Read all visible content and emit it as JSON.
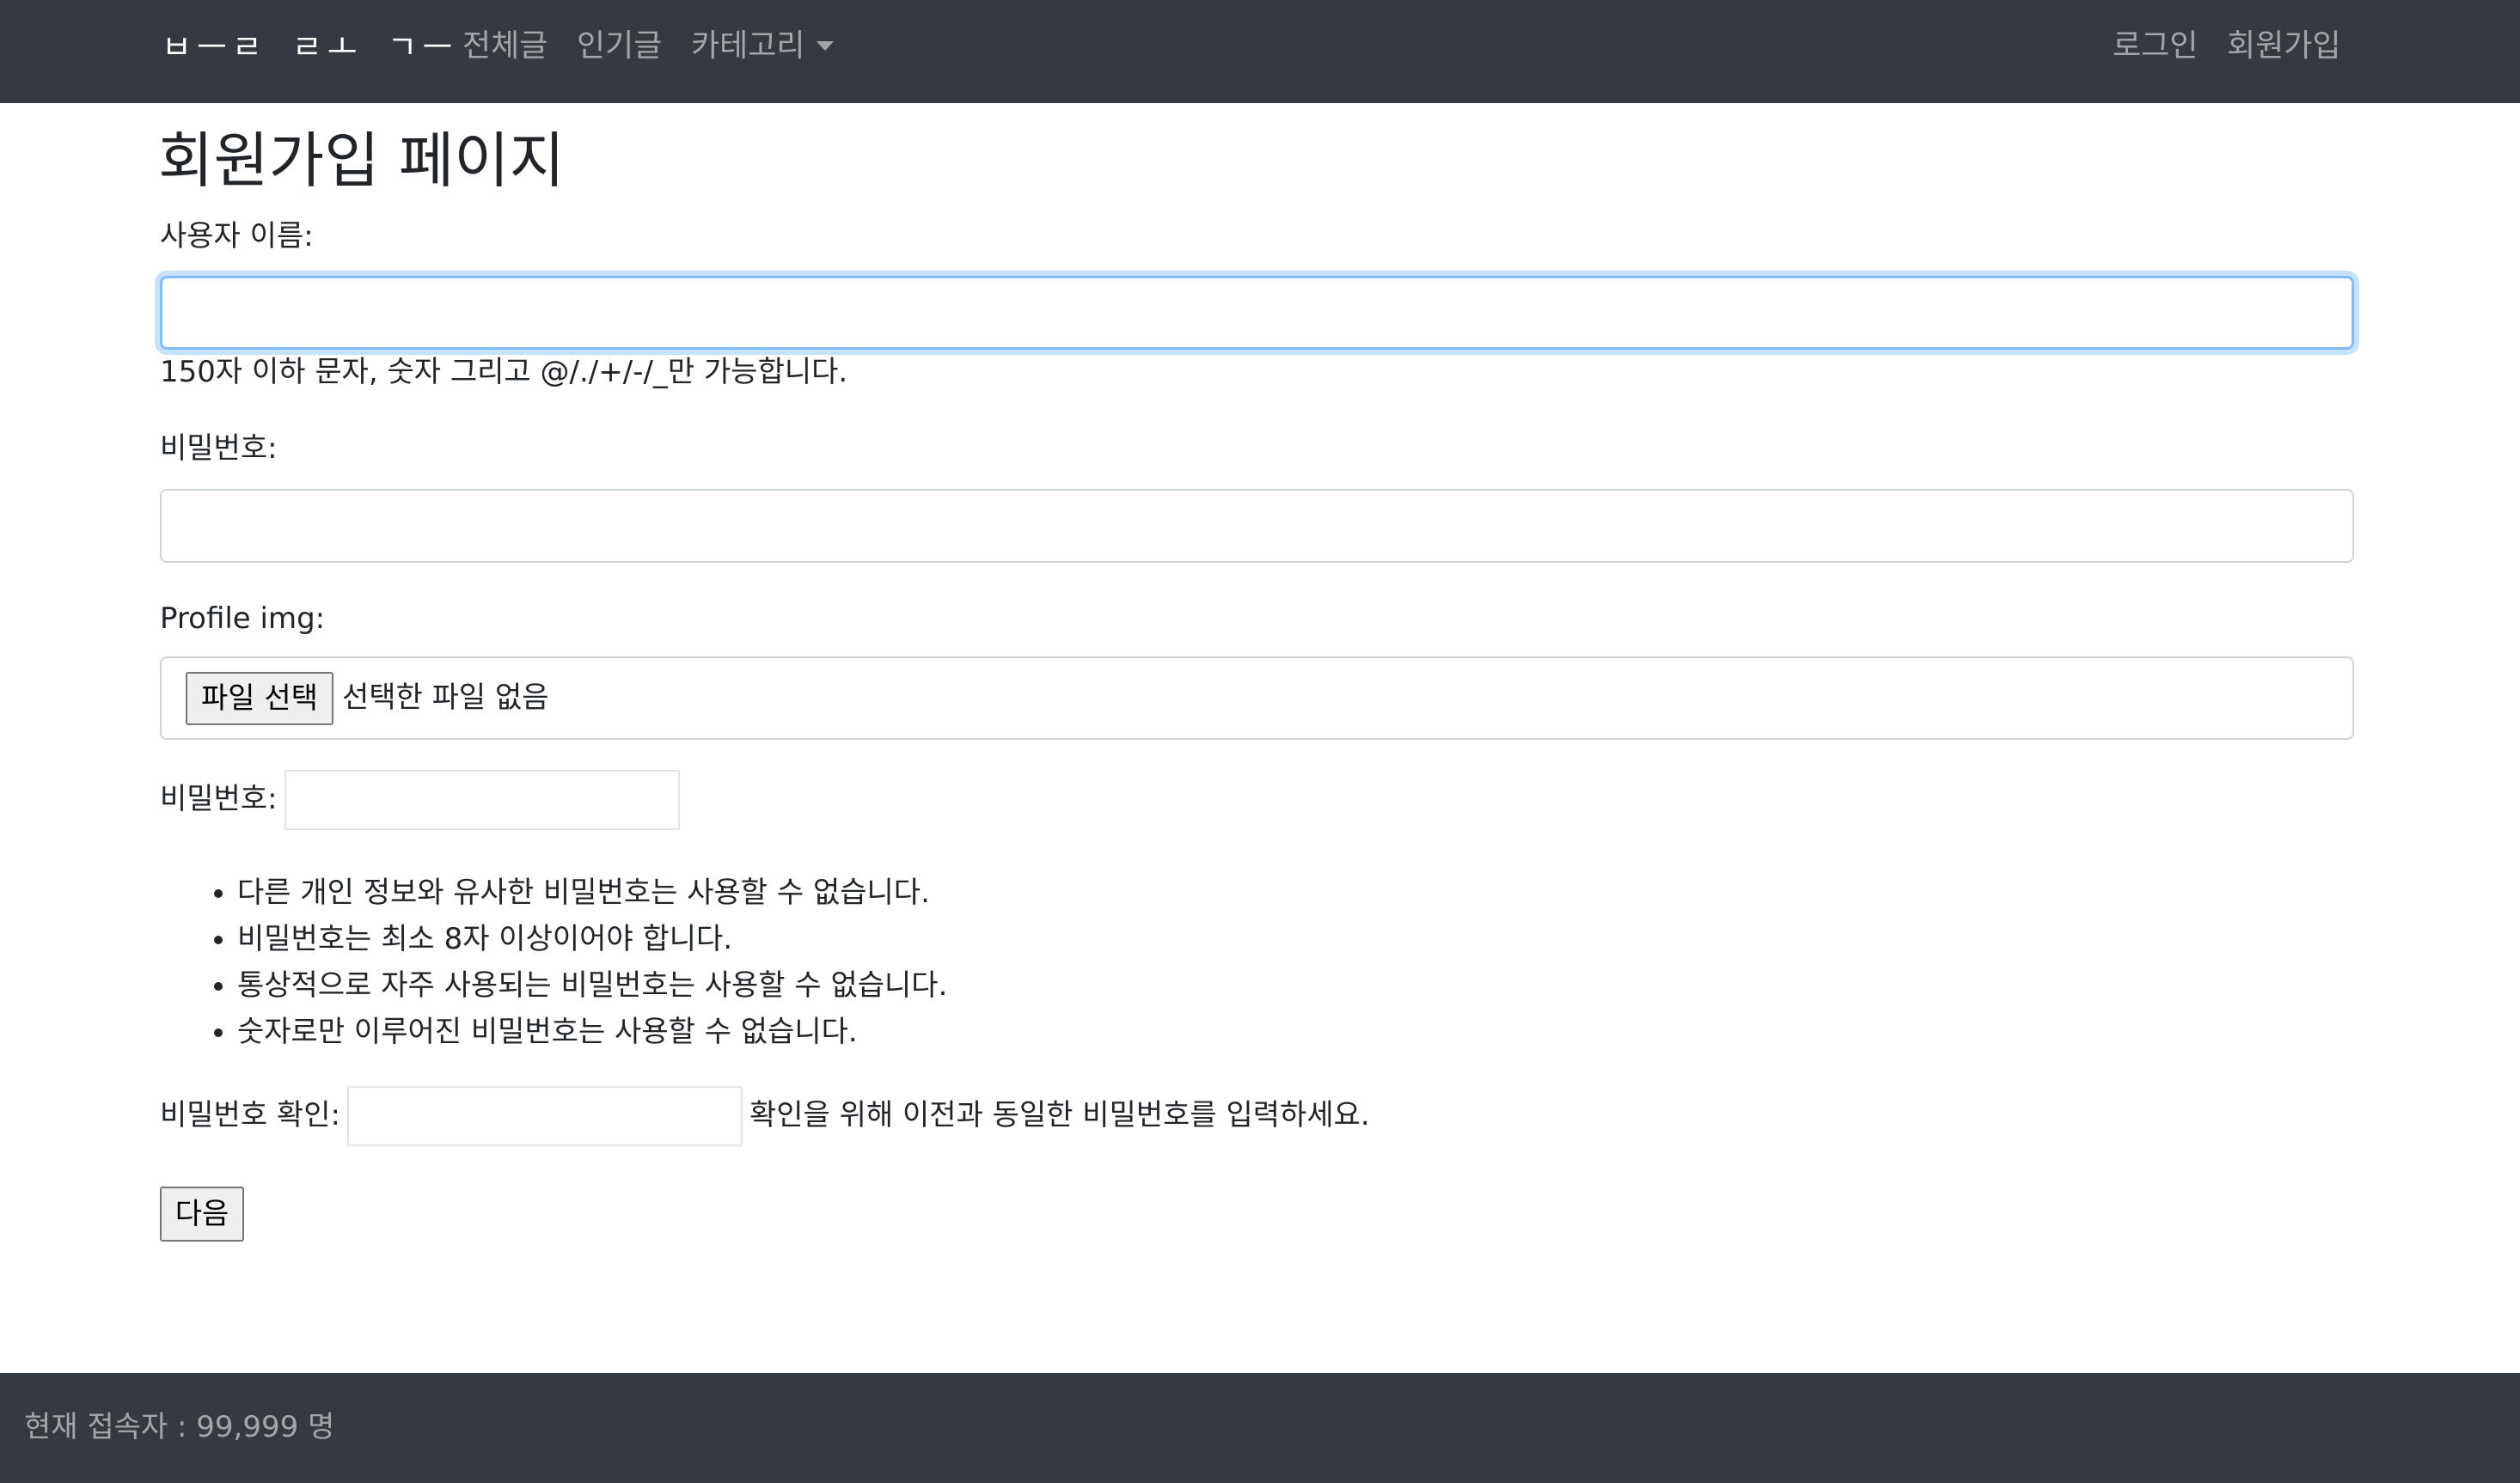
{
  "navbar": {
    "brand": "ㅂㅡㄹ ㄹㅗ ㄱㅡ",
    "links": {
      "all_posts": "전체글",
      "popular": "인기글",
      "category": "카테고리"
    },
    "login": "로그인",
    "signup": "회원가입"
  },
  "page": {
    "title": "회원가입 페이지"
  },
  "form": {
    "username_label": "사용자 이름:",
    "username_value": "",
    "username_help": "150자 이하 문자, 숫자 그리고 @/./+/-/_만 가능합니다.",
    "password_label": "비밀번호:",
    "password_value": "",
    "profile_label": "Profile img:",
    "file_button": "파일 선택",
    "file_status": "선택한 파일 없음",
    "password2_label": "비밀번호:",
    "password_rules": [
      "다른 개인 정보와 유사한 비밀번호는 사용할 수 없습니다.",
      "비밀번호는 최소 8자 이상이어야 합니다.",
      "통상적으로 자주 사용되는 비밀번호는 사용할 수 없습니다.",
      "숫자로만 이루어진 비밀번호는 사용할 수 없습니다."
    ],
    "confirm_label": "비밀번호 확인:",
    "confirm_help": "확인을 위해 이전과 동일한 비밀번호를 입력하세요.",
    "next_button": "다음"
  },
  "footer": {
    "visitors": "현재 접속자 : 99,999 명"
  },
  "colors": {
    "navbar_bg": "#343a40",
    "focus_ring": "#80bdff",
    "text": "#212529"
  }
}
